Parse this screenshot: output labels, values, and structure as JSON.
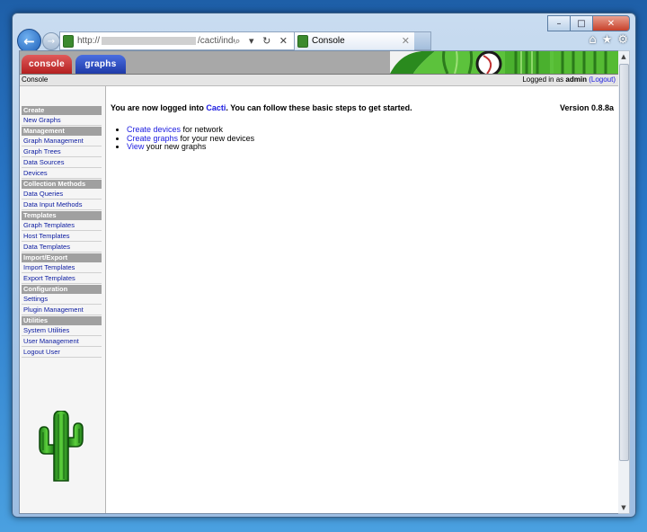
{
  "browser": {
    "address_prefix": "http://",
    "address_path": "/cacti/index.php",
    "tab_title": "Console",
    "win_minimize": "–",
    "win_maximize": "□",
    "win_close": "✕",
    "address_icons": "⌕ ▾ ↻ ✕",
    "back_glyph": "←",
    "forward_glyph": "→",
    "tab_close_glyph": "✕",
    "tool_icons": [
      "home-icon",
      "star-icon",
      "gear-icon"
    ]
  },
  "cacti": {
    "tabs": [
      "console",
      "graphs"
    ],
    "breadcrumb": "Console",
    "logged_in_prefix": "Logged in as",
    "user": "admin",
    "logout_label": "(Logout)"
  },
  "sidebar": {
    "sections": [
      {
        "title": "Create",
        "items": [
          "New Graphs"
        ]
      },
      {
        "title": "Management",
        "items": [
          "Graph Management",
          "Graph Trees",
          "Data Sources",
          "Devices"
        ]
      },
      {
        "title": "Collection Methods",
        "items": [
          "Data Queries",
          "Data Input Methods"
        ]
      },
      {
        "title": "Templates",
        "items": [
          "Graph Templates",
          "Host Templates",
          "Data Templates"
        ]
      },
      {
        "title": "Import/Export",
        "items": [
          "Import Templates",
          "Export Templates"
        ]
      },
      {
        "title": "Configuration",
        "items": [
          "Settings",
          "Plugin Management"
        ]
      },
      {
        "title": "Utilities",
        "items": [
          "System Utilities",
          "User Management",
          "Logout User"
        ]
      }
    ]
  },
  "main": {
    "welcome_prefix": "You are now logged into",
    "welcome_link": "Cacti",
    "welcome_suffix": ". You can follow these basic steps to get started.",
    "version": "Version 0.8.8a",
    "steps": [
      {
        "link": "Create devices",
        "rest": " for network"
      },
      {
        "link": "Create graphs",
        "rest": " for your new devices"
      },
      {
        "link": "View",
        "rest": " your new graphs"
      }
    ]
  },
  "colors": {
    "console_tab": "#c83030",
    "graphs_tab": "#2a48c0",
    "link": "#1a1ae0",
    "section_header": "#a0a0a0"
  }
}
